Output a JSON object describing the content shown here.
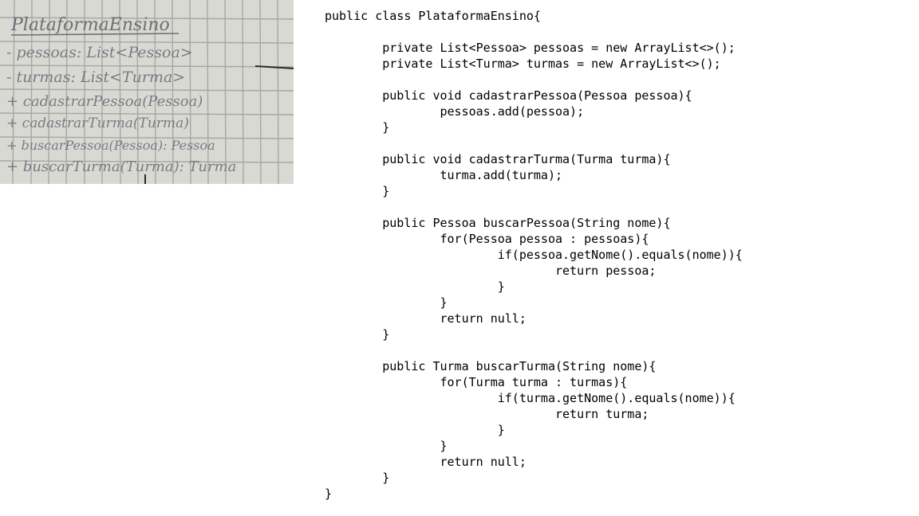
{
  "note_photo": {
    "title": "PlataformaEnsino",
    "lines": [
      "- pessoas: List<Pessoa>",
      "- turmas: List<Turma>",
      "+ cadastrarPessoa(Pessoa)",
      "+ cadastrarTurma(Turma)",
      "+ buscarPessoa(Pessoa): Pessoa",
      "+ buscarTurma(Turma): Turma"
    ],
    "ink_color": "#6e6e78",
    "paper_color": "#d8d8d3"
  },
  "code": {
    "lines": [
      "public class PlataformaEnsino{",
      "",
      "        private List<Pessoa> pessoas = new ArrayList<>();",
      "        private List<Turma> turmas = new ArrayList<>();",
      "",
      "        public void cadastrarPessoa(Pessoa pessoa){",
      "                pessoas.add(pessoa);",
      "        }",
      "",
      "        public void cadastrarTurma(Turma turma){",
      "                turma.add(turma);",
      "        }",
      "",
      "        public Pessoa buscarPessoa(String nome){",
      "                for(Pessoa pessoa : pessoas){",
      "                        if(pessoa.getNome().equals(nome)){",
      "                                return pessoa;",
      "                        }",
      "                }",
      "                return null;",
      "        }",
      "",
      "        public Turma buscarTurma(String nome){",
      "                for(Turma turma : turmas){",
      "                        if(turma.getNome().equals(nome)){",
      "                                return turma;",
      "                        }",
      "                }",
      "                return null;",
      "        }",
      "}"
    ]
  }
}
